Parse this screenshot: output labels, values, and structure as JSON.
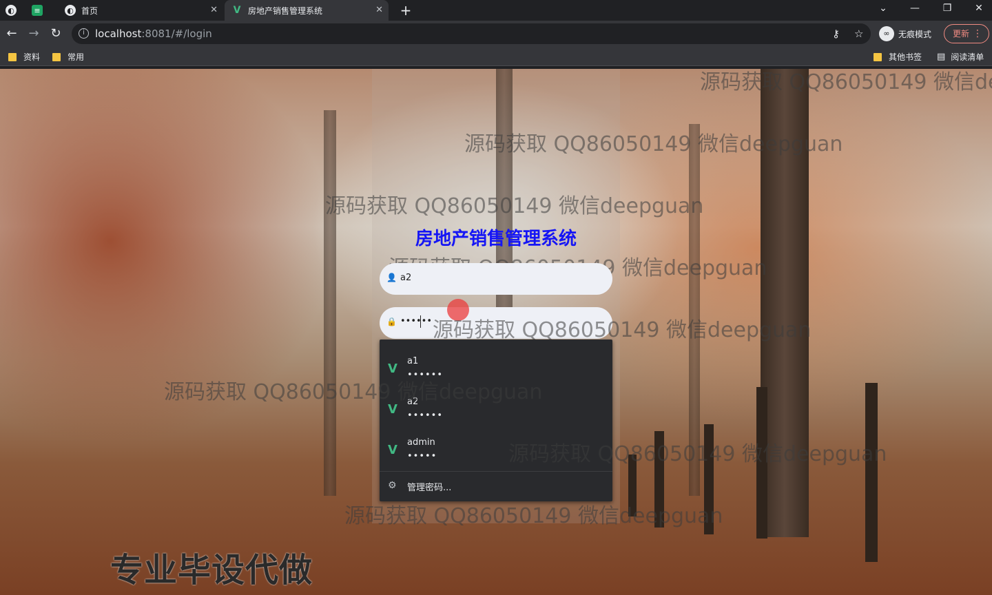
{
  "browser": {
    "tabs": [
      {
        "title": "首页",
        "active": false
      },
      {
        "title": "房地产销售管理系统",
        "active": true
      }
    ],
    "new_tab": "+",
    "window_controls": [
      "chevron-down-icon",
      "minimize-icon",
      "restore-icon",
      "close-icon"
    ],
    "url_host": "localhost",
    "url_rest": ":8081/#/login",
    "incognito_label": "无痕模式",
    "update_label": "更新",
    "bookmarks": [
      "资料",
      "常用"
    ],
    "other_bookmarks": "其他书签",
    "reading_list": "阅读清单"
  },
  "colors": {
    "title_blue": "#1515f5",
    "vue_green": "#41b883",
    "update_red": "#f28b82",
    "chrome_dark": "#202124",
    "chrome_mid": "#35363a",
    "folder_yellow": "#f5c542"
  },
  "login": {
    "title": "房地产销售管理系统",
    "username_value": "a2",
    "password_value": "••••••"
  },
  "autofill": {
    "items": [
      {
        "user": "a1",
        "pass": "••••••"
      },
      {
        "user": "a2",
        "pass": "••••••"
      },
      {
        "user": "admin",
        "pass": "•••••"
      }
    ],
    "manage_label": "管理密码..."
  },
  "watermarks": {
    "text": "源码获取 QQ86050149 微信deepguan",
    "top_right_text": "源码获取 QQ86050149 微信de"
  },
  "promo_text": "专业毕设代做"
}
